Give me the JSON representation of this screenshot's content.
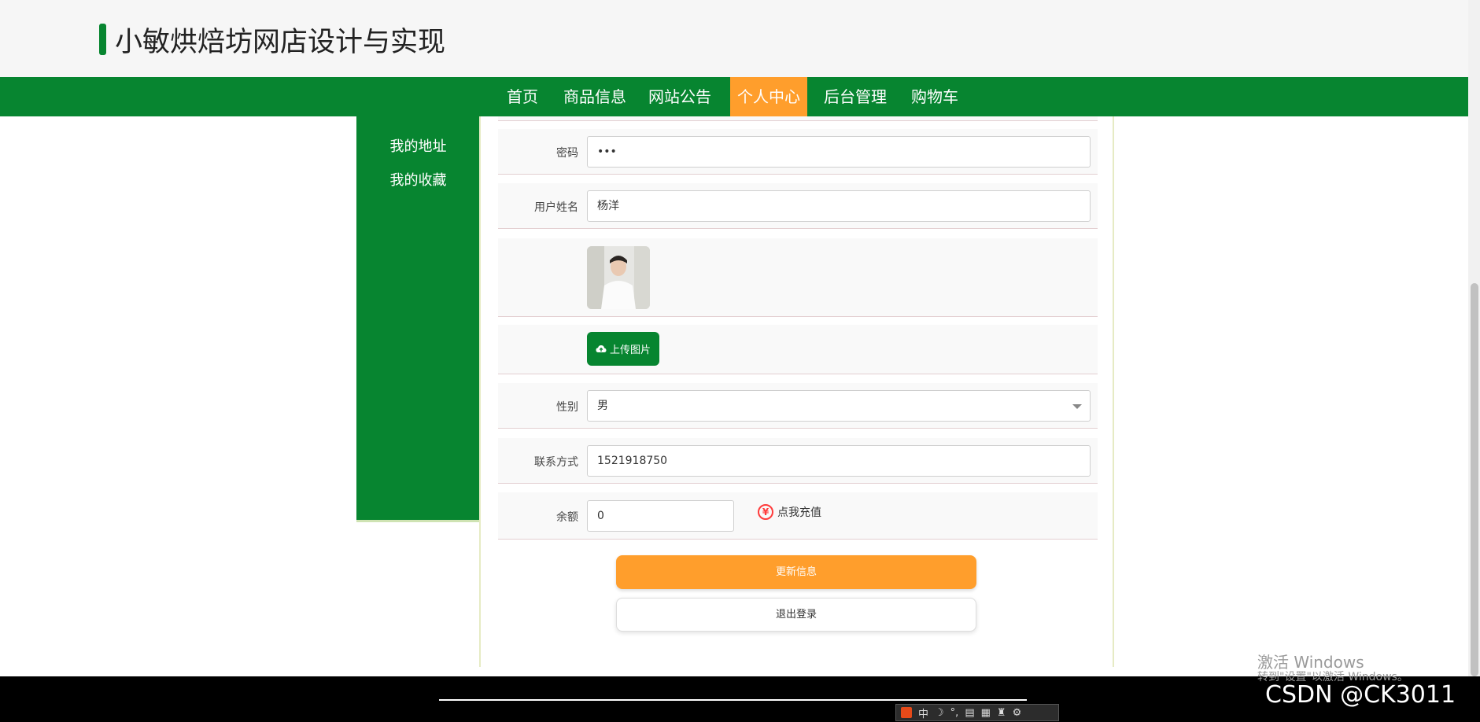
{
  "header": {
    "title": "小敏烘焙坊网店设计与实现"
  },
  "nav": {
    "items": [
      {
        "label": "首页"
      },
      {
        "label": "商品信息"
      },
      {
        "label": "网站公告"
      },
      {
        "label": "个人中心",
        "active": true
      },
      {
        "label": "后台管理"
      },
      {
        "label": "购物车"
      }
    ]
  },
  "sidebar": {
    "items": [
      {
        "label": "我的地址"
      },
      {
        "label": "我的收藏"
      }
    ]
  },
  "form": {
    "password": {
      "label": "密码",
      "value": "•••"
    },
    "name": {
      "label": "用户姓名",
      "value": "杨洋"
    },
    "upload_label": "上传图片",
    "gender": {
      "label": "性别",
      "value": "男"
    },
    "phone": {
      "label": "联系方式",
      "value": "1521918750"
    },
    "balance": {
      "label": "余额",
      "value": "0"
    },
    "recharge_label": "点我充值",
    "yen_symbol": "¥"
  },
  "buttons": {
    "update": "更新信息",
    "logout": "退出登录"
  },
  "overlay": {
    "activate_title": "激活 Windows",
    "activate_sub": "转到\"设置\"以激活 Windows。",
    "csdn": "CSDN @CK3011",
    "ime_lang": "中"
  },
  "colors": {
    "primary": "#078530",
    "accent": "#ff9e2c"
  }
}
